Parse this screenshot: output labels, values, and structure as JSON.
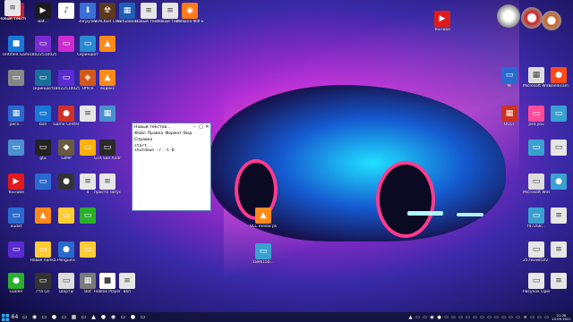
{
  "desktop_icons": [
    {
      "id": "i1",
      "label": "",
      "glyph": "▣",
      "color": "#c02030"
    },
    {
      "id": "i2",
      "label": "Bat...",
      "glyph": "▶",
      "color": "#1c1c1c"
    },
    {
      "id": "i3",
      "label": "",
      "glyph": "♪",
      "color": "#ffffff"
    },
    {
      "id": "i4",
      "label": "Загрузки",
      "glyph": "⬇",
      "color": "#3a6fd6"
    },
    {
      "id": "i5",
      "label": "STALKER Clear Sky",
      "glyph": "☢",
      "color": "#5c3a1a"
    },
    {
      "id": "i6",
      "label": "VirtualBox",
      "glyph": "▦",
      "color": "#1e5fb3"
    },
    {
      "id": "i7",
      "label": "Новый текстовый",
      "glyph": "≡",
      "color": "#e6e6e6"
    },
    {
      "id": "i8",
      "label": "Новый текстовый",
      "glyph": "≡",
      "color": "#e6e6e6"
    },
    {
      "id": "i9",
      "label": "Мозила ФФ Б...",
      "glyph": "◉",
      "color": "#ff7a1a"
    },
    {
      "id": "i10",
      "label": "Untitled Game",
      "glyph": "■",
      "color": "#1878d8"
    },
    {
      "id": "i11",
      "label": "18022510025",
      "glyph": "▭",
      "color": "#7a2bd0"
    },
    {
      "id": "i12",
      "label": "",
      "glyph": "▭",
      "color": "#d02bd0"
    },
    {
      "id": "i13",
      "label": "Скриншот",
      "glyph": "▭",
      "color": "#2a8bd0"
    },
    {
      "id": "i14",
      "label": "",
      "glyph": "▲",
      "color": "#ff8a1a"
    },
    {
      "id": "i15",
      "label": "",
      "glyph": "▭",
      "color": "#888888"
    },
    {
      "id": "i16",
      "label": "скриншот",
      "glyph": "▭",
      "color": "#1b6d9a"
    },
    {
      "id": "i17",
      "label": "18022510025",
      "glyph": "▭",
      "color": "#5a2bd0"
    },
    {
      "id": "i18",
      "label": "Office",
      "glyph": "◈",
      "color": "#d05a1a"
    },
    {
      "id": "i19",
      "label": "яндекс",
      "glyph": "▲",
      "color": "#ff8a1a"
    },
    {
      "id": "i20",
      "label": "рисо...",
      "glyph": "▦",
      "color": "#2a6ad0"
    },
    {
      "id": "i21",
      "label": "ball",
      "glyph": "▭",
      "color": "#1878d8"
    },
    {
      "id": "i22",
      "label": "Game Center",
      "glyph": "●",
      "color": "#d0302a"
    },
    {
      "id": "i23",
      "label": "",
      "glyph": "≡",
      "color": "#e6e6e6"
    },
    {
      "id": "i24",
      "label": "",
      "glyph": "▦",
      "color": "#4a90d0"
    },
    {
      "id": "i25",
      "label": "",
      "glyph": "▭",
      "color": "#4a90d0"
    },
    {
      "id": "i26",
      "label": "gta",
      "glyph": "▭",
      "color": "#222222"
    },
    {
      "id": "i27",
      "label": "GIMP",
      "glyph": "◆",
      "color": "#6a5a40"
    },
    {
      "id": "i28",
      "label": "",
      "glyph": "▭",
      "color": "#ffb000"
    },
    {
      "id": "i29",
      "label": "GTA San Andreas",
      "glyph": "▭",
      "color": "#2a2a2a"
    },
    {
      "id": "i30",
      "label": "YouTube",
      "glyph": "▶",
      "color": "#e01b1b"
    },
    {
      "id": "i31",
      "label": "",
      "glyph": "▭",
      "color": "#2a6ad0"
    },
    {
      "id": "i32",
      "label": "",
      "glyph": "●",
      "color": "#333333"
    },
    {
      "id": "i33",
      "label": "d",
      "glyph": "≡",
      "color": "#e6e6e6"
    },
    {
      "id": "i34",
      "label": "просто запуск видео",
      "glyph": "≡",
      "color": "#e6e6e6"
    },
    {
      "id": "i35",
      "label": "audat",
      "glyph": "▭",
      "color": "#2a6ad0"
    },
    {
      "id": "i36",
      "label": "",
      "glyph": "▲",
      "color": "#ff8a1a"
    },
    {
      "id": "i37",
      "label": "",
      "glyph": "▭",
      "color": "#ffcc33"
    },
    {
      "id": "i38",
      "label": "",
      "glyph": "▭",
      "color": "#2bb02b"
    },
    {
      "id": "i39",
      "label": "",
      "glyph": "▭",
      "color": "#5a2bd0"
    },
    {
      "id": "i40",
      "label": "Новая папка",
      "glyph": "▭",
      "color": "#ffcc33"
    },
    {
      "id": "i41",
      "label": "Penguins",
      "glyph": "●",
      "color": "#2a6ad0"
    },
    {
      "id": "i42",
      "label": "",
      "glyph": "▭",
      "color": "#ffcc33"
    },
    {
      "id": "i43",
      "label": "Loader",
      "glyph": "●",
      "color": "#2bb02b"
    },
    {
      "id": "i44",
      "label": "гта (2)",
      "glyph": "▭",
      "color": "#333333"
    },
    {
      "id": "i45",
      "label": "Шорты",
      "glyph": "▭",
      "color": "#dddddd"
    },
    {
      "id": "i46",
      "label": "Bot",
      "glyph": "▦",
      "color": "#7a7a7a"
    },
    {
      "id": "i47",
      "label": "Roblox Player",
      "glyph": "■",
      "color": "#ffffff"
    },
    {
      "id": "i48",
      "label": "вбп",
      "glyph": "≡",
      "color": "#e6e6e6"
    },
    {
      "id": "i49",
      "label": "YouTube",
      "glyph": "▶",
      "color": "#e01b1b"
    },
    {
      "id": "i50",
      "label": "Mi",
      "glyph": "▭",
      "color": "#2a6ad0"
    },
    {
      "id": "i51",
      "label": "Microsoft Wireless Em...",
      "glyph": "▦",
      "color": "#dddddd"
    },
    {
      "id": "i52",
      "label": "Bandicam",
      "glyph": "●",
      "color": "#ff4a1a"
    },
    {
      "id": "i53",
      "label": "OCCT",
      "glyph": "▦",
      "color": "#cc3322"
    },
    {
      "id": "i54",
      "label": "psd.you",
      "glyph": "▭",
      "color": "#ff4a9a"
    },
    {
      "id": "i55",
      "label": "",
      "glyph": "▭",
      "color": "#3aa0d0"
    },
    {
      "id": "i56",
      "label": "",
      "glyph": "▭",
      "color": "#3aa0d0"
    },
    {
      "id": "i57",
      "label": "",
      "glyph": "▭",
      "color": "#e6e6e6"
    },
    {
      "id": "i58",
      "label": "Microsoft Wireless ...",
      "glyph": "▭",
      "color": "#dddddd"
    },
    {
      "id": "i59",
      "label": "",
      "glyph": "●",
      "color": "#3aa0d0"
    },
    {
      "id": "i60",
      "label": "",
      "glyph": "≡",
      "color": "#e6e6e6"
    },
    {
      "id": "i61",
      "label": "f47268...",
      "glyph": "▭",
      "color": "#3aa0d0"
    },
    {
      "id": "i62",
      "label": "2578184f2f2...",
      "glyph": "▭",
      "color": "#e6e6e6"
    },
    {
      "id": "i63",
      "label": "",
      "glyph": "≡",
      "color": "#e6e6e6"
    },
    {
      "id": "i64",
      "label": "",
      "glyph": "≡",
      "color": "#e6e6e6"
    },
    {
      "id": "i65",
      "label": "Рисунок OpenOffice...",
      "glyph": "▭",
      "color": "#e6e6e6"
    },
    {
      "id": "i66",
      "label": "VLC media player",
      "glyph": "▲",
      "color": "#ff8a1a"
    },
    {
      "id": "i67",
      "label": "18e615b...",
      "glyph": "▭",
      "color": "#3aa0d0"
    },
    {
      "id": "i68",
      "label": "",
      "glyph": "≡",
      "color": "#e6e6e6"
    },
    {
      "id": "i69",
      "label": "",
      "glyph": "▭",
      "color": "#3a6fd6"
    },
    {
      "id": "i70",
      "label": "Новый текстовый",
      "glyph": "≡",
      "color": "#e6e6e6"
    },
    {
      "id": "i71",
      "label": "Новый текстовый",
      "glyph": "≡",
      "color": "#e6e6e6"
    }
  ],
  "notepad": {
    "title": "Новый текстов...",
    "menu": [
      "Файл",
      "Правка",
      "Формат",
      "Вид"
    ],
    "menu2": "Справка",
    "lines": [
      "start",
      "shutdown -r -t 0"
    ]
  },
  "taskbar": {
    "start_icon": "windows-logo",
    "items": [
      "64",
      "▭",
      "◉",
      "▭",
      "●",
      "▭",
      "▦",
      "▭",
      "▲",
      "●",
      "◉",
      "▭",
      "●",
      "▭"
    ],
    "tray_items": [
      "▲",
      "▭",
      "▭",
      "◉",
      "●",
      "▭",
      "▭",
      "▭",
      "▭",
      "▭",
      "▭",
      "▭",
      "▭",
      "▭",
      "▭",
      "▭",
      "я",
      "▭",
      "▭",
      "▭"
    ],
    "time": "21:28",
    "date": "14.09.2021"
  },
  "colors": {
    "taskbar": "#14123c",
    "window_border": "#5a7fbf"
  }
}
